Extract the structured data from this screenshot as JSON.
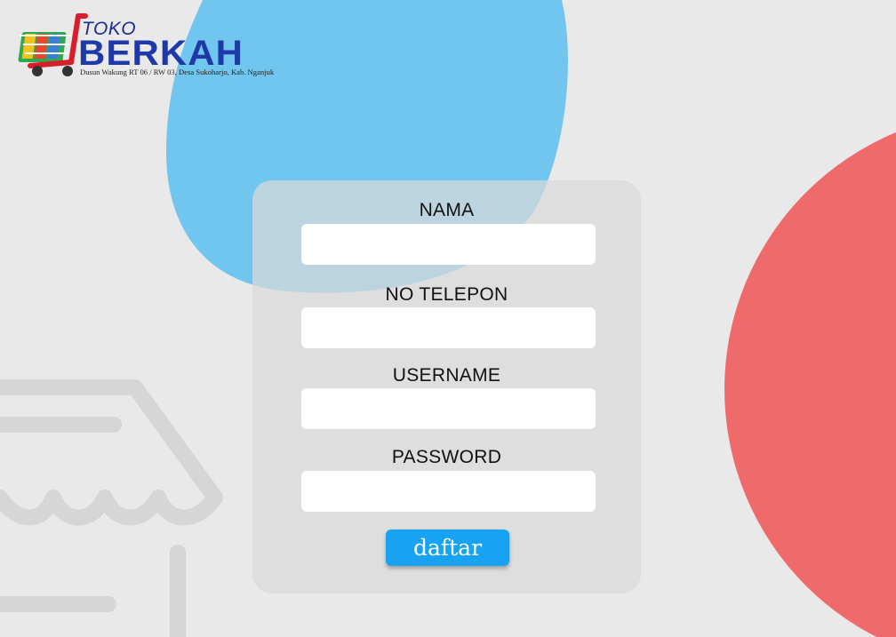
{
  "brand": {
    "name_small": "TOKO",
    "name_large": "BERKAH",
    "address": "Dusun Wakung RT 06 / RW 03, Desa Sukoharjo, Kab. Nganjuk",
    "icon": "shopping-cart-icon"
  },
  "form": {
    "fields": [
      {
        "label": "NAMA",
        "value": ""
      },
      {
        "label": "NO TELEPON",
        "value": ""
      },
      {
        "label": "USERNAME",
        "value": ""
      },
      {
        "label": "PASSWORD",
        "value": ""
      }
    ],
    "submit_label": "daftar"
  },
  "colors": {
    "background": "#e9e9e9",
    "blue_blob": "#4fbdf1",
    "red_circle": "#ef6b6b",
    "button": "#17a2f2",
    "brand_blue": "#1d3aa8"
  }
}
